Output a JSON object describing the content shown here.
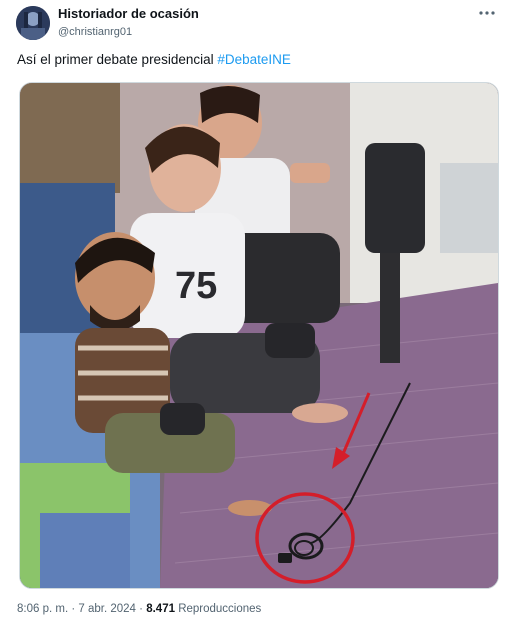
{
  "author": {
    "display_name": "Historiador de ocasión",
    "handle": "@christianrg01",
    "avatar_icon": "avatar-photo-icon"
  },
  "menu": {
    "icon": "more-horizontal-icon"
  },
  "tweet": {
    "text": "Así el primer debate presidencial",
    "hashtag": "#DebateINE"
  },
  "media": {
    "icon": "photo-icon",
    "accent_circle_color": "#d41e2a",
    "accent_arrow_color": "#d41e2a"
  },
  "meta": {
    "time": "8:06 p. m.",
    "separator": "·",
    "date": "7 abr. 2024",
    "separator2": "·",
    "views_count": "8.471",
    "views_label": "Reproducciones"
  },
  "colors": {
    "text_primary": "#0f1419",
    "text_secondary": "#536471",
    "link": "#1d9bf0",
    "border": "#cfd9de"
  }
}
